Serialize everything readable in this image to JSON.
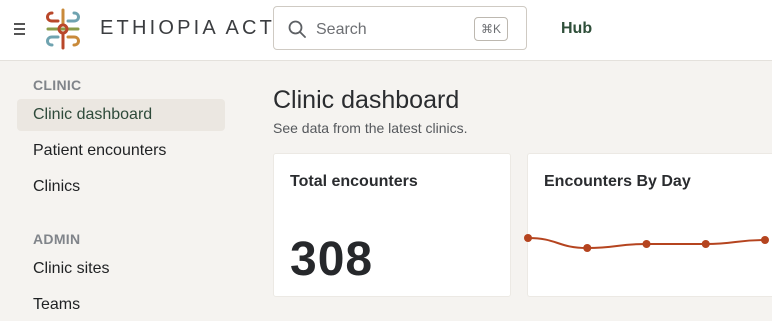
{
  "header": {
    "brand": "ETHIOPIA ACT",
    "search_placeholder": "Search",
    "search_shortcut": "⌘K",
    "hub_label": "Hub",
    "menu_icon": "hamburger-icon",
    "logo_colors": [
      "#b9472a",
      "#c98a3a",
      "#6fa3b0",
      "#8a9c4a"
    ]
  },
  "sidebar": {
    "sections": [
      {
        "label": "CLINIC",
        "items": [
          {
            "label": "Clinic dashboard",
            "active": true
          },
          {
            "label": "Patient encounters",
            "active": false
          },
          {
            "label": "Clinics",
            "active": false
          }
        ]
      },
      {
        "label": "ADMIN",
        "items": [
          {
            "label": "Clinic sites",
            "active": false
          },
          {
            "label": "Teams",
            "active": false
          }
        ]
      }
    ]
  },
  "main": {
    "title": "Clinic dashboard",
    "subtitle": "See data from the latest clinics."
  },
  "cards": {
    "total": {
      "title": "Total encounters",
      "value": "308"
    },
    "by_day": {
      "title": "Encounters By Day"
    }
  },
  "chart_data": {
    "type": "line",
    "title": "Encounters By Day",
    "series": [
      {
        "values": [
          58,
          53,
          55,
          55,
          57
        ]
      }
    ],
    "ylim": [
      40,
      70
    ],
    "color": "#b5441f",
    "grid": false
  }
}
